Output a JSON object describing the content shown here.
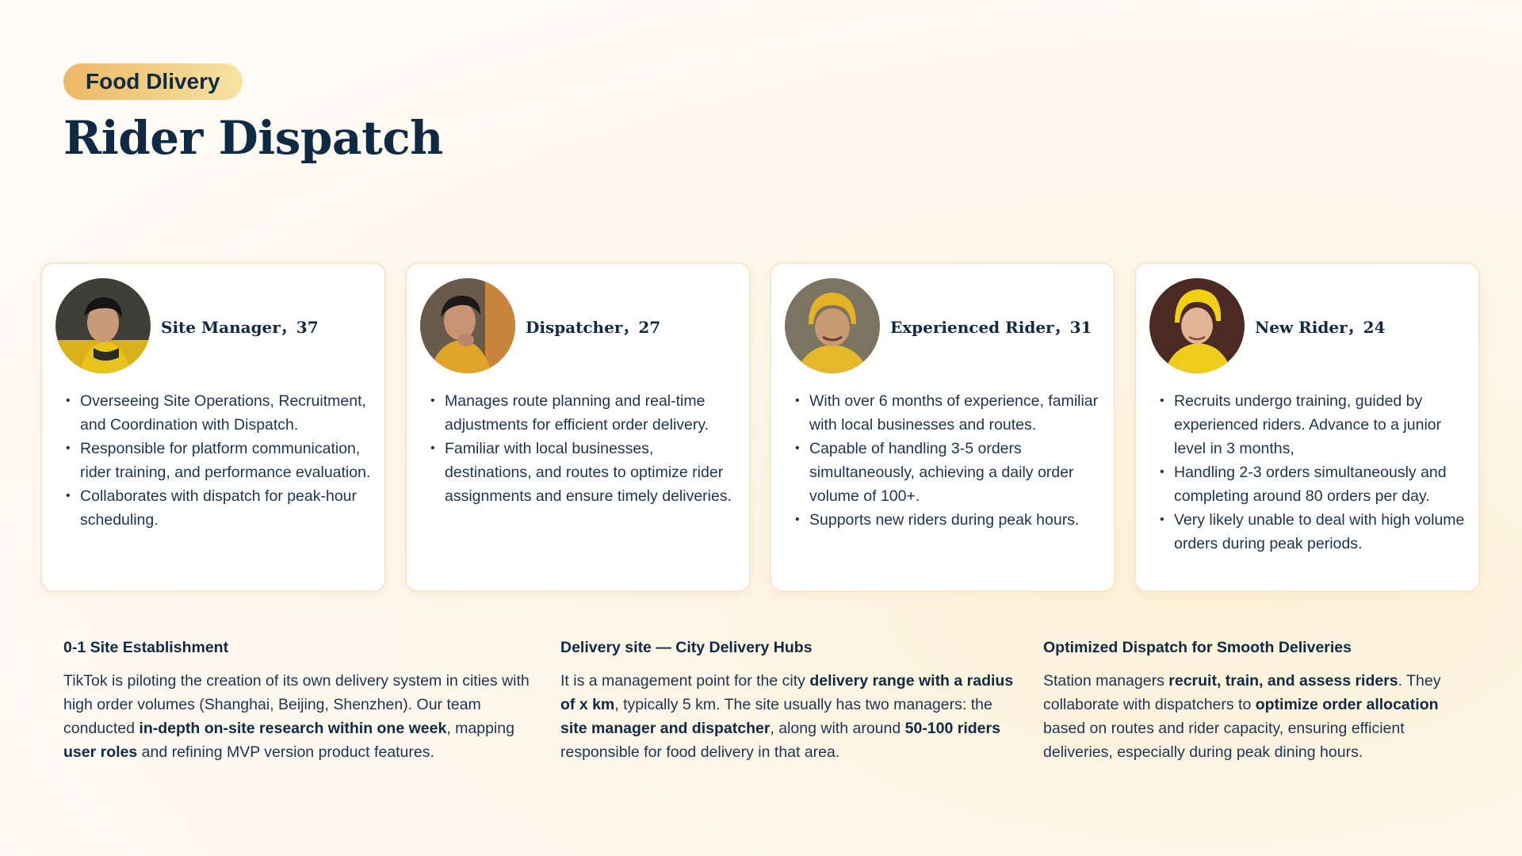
{
  "header": {
    "tag": "Food Dlivery",
    "title": "Rider Dispatch"
  },
  "cards": [
    {
      "name": "Site Manager，37",
      "avatar_icon": "person-photo",
      "bullets": [
        "Overseeing Site Operations, Recruitment, and Coordination with Dispatch.",
        "Responsible for platform communication, rider training, and performance evaluation.",
        "Collaborates with dispatch for peak-hour scheduling."
      ]
    },
    {
      "name": "Dispatcher，27",
      "avatar_icon": "person-photo",
      "bullets": [
        "Manages route planning and real-time adjustments for efficient order delivery.",
        "Familiar with local businesses, destinations, and routes to optimize rider assignments and ensure timely deliveries."
      ]
    },
    {
      "name": "Experienced Rider，31",
      "avatar_icon": "person-photo",
      "bullets": [
        "With over 6 months of experience, familiar with local businesses and routes.",
        "Capable of handling 3-5 orders simultaneously, achieving a daily order volume of 100+.",
        "Supports new riders during peak hours."
      ]
    },
    {
      "name": "New Rider，24",
      "avatar_icon": "person-photo",
      "bullets": [
        "Recruits undergo training, guided by experienced riders. Advance to a junior level in 3 months,",
        "Handling 2-3 orders simultaneously and completing around 80 orders per day.",
        "Very likely unable to deal with high volume orders during peak periods."
      ]
    }
  ],
  "info": [
    {
      "heading": "0-1 Site Establishment",
      "parts": [
        {
          "t": "TikTok is piloting the creation of its own delivery system in cities with high order volumes (Shanghai, Beijing, Shenzhen). Our team conducted ",
          "b": false
        },
        {
          "t": "in-depth on-site research within one week",
          "b": true
        },
        {
          "t": ", mapping ",
          "b": false
        },
        {
          "t": "user roles",
          "b": true
        },
        {
          "t": " and refining MVP version product features.",
          "b": false
        }
      ]
    },
    {
      "heading": "Delivery site — City Delivery Hubs",
      "parts": [
        {
          "t": "It is a management point for the city ",
          "b": false
        },
        {
          "t": "delivery range with a radius of x km",
          "b": true
        },
        {
          "t": ", typically 5 km. The site usually has two managers: the ",
          "b": false
        },
        {
          "t": "site manager and dispatcher",
          "b": true
        },
        {
          "t": ", along with around ",
          "b": false
        },
        {
          "t": "50-100 riders",
          "b": true
        },
        {
          "t": " responsible for food delivery in that area.",
          "b": false
        }
      ]
    },
    {
      "heading": "Optimized Dispatch for Smooth Deliveries",
      "parts": [
        {
          "t": "Station managers ",
          "b": false
        },
        {
          "t": "recruit, train, and assess riders",
          "b": true
        },
        {
          "t": ". They collaborate with dispatchers to ",
          "b": false
        },
        {
          "t": "optimize order allocation",
          "b": true
        },
        {
          "t": " based on routes and rider capacity, ensuring efficient deliveries, especially during peak dining hours.",
          "b": false
        }
      ]
    }
  ]
}
